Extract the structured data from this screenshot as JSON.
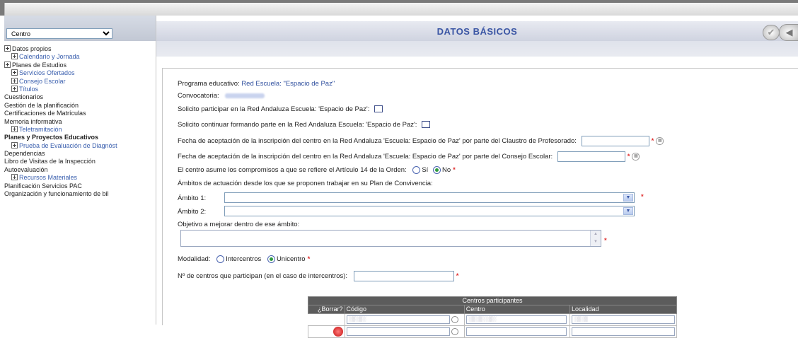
{
  "sidebar": {
    "selector_value": "Centro",
    "items": [
      {
        "label": "Datos propios",
        "expand": true,
        "style": "plain"
      },
      {
        "label": "Calendario y Jornada",
        "expand": true,
        "style": "blue"
      },
      {
        "label": "Planes de Estudios",
        "expand": true,
        "style": "plain"
      },
      {
        "label": "Servicios Ofertados",
        "expand": true,
        "style": "blue"
      },
      {
        "label": "Consejo Escolar",
        "expand": true,
        "style": "blue"
      },
      {
        "label": "Títulos",
        "expand": true,
        "style": "blue"
      },
      {
        "label": "Cuestionarios",
        "expand": false,
        "style": "plain"
      },
      {
        "label": "Gestión de la planificación",
        "expand": false,
        "style": "plain"
      },
      {
        "label": "Certificaciones de Matrículas",
        "expand": false,
        "style": "plain"
      },
      {
        "label": "Memoria informativa",
        "expand": false,
        "style": "plain"
      },
      {
        "label": "Teletramitación",
        "expand": true,
        "style": "blue"
      },
      {
        "label": "Planes y Proyectos Educativos",
        "expand": false,
        "style": "bold"
      },
      {
        "label": "Prueba de Evaluación de Diagnóst",
        "expand": true,
        "style": "blue"
      },
      {
        "label": "Dependencias",
        "expand": false,
        "style": "plain"
      },
      {
        "label": "Libro de Visitas de la Inspección",
        "expand": false,
        "style": "plain"
      },
      {
        "label": "Autoevaluación",
        "expand": false,
        "style": "plain"
      },
      {
        "label": "Recursos Materiales",
        "expand": true,
        "style": "blue"
      },
      {
        "label": "Planificación Servicios PAC",
        "expand": false,
        "style": "plain"
      },
      {
        "label": "Organización y funcionamiento de bil",
        "expand": false,
        "style": "plain"
      }
    ]
  },
  "header": {
    "title": "DATOS BÁSICOS"
  },
  "form": {
    "programa_label": "Programa educativo:",
    "programa_value": "Red Escuela: \"Espacio de Paz\"",
    "convocatoria_label": "Convocatoria:",
    "solicito_participar": "Solicito participar en la Red Andaluza Escuela: 'Espacio de Paz':",
    "solicito_continuar": "Solicito continuar formando parte en la Red Andaluza Escuela: 'Espacio de Paz':",
    "fecha_claustro": "Fecha de aceptación de la inscripción del centro en la Red Andaluza 'Escuela: Espacio de Paz' por parte del Claustro de Profesorado:",
    "fecha_consejo": "Fecha de aceptación de la inscripción del centro en la Red Andaluza 'Escuela: Espacio de Paz' por parte del Consejo Escolar:",
    "compromisos_label": "El centro asume los compromisos a que se refiere el Artículo 14 de la Orden:",
    "opt_si": "Sí",
    "opt_no": "No",
    "ambitos_label": "Ámbitos de actuación desde los que se proponen trabajar en su Plan de Convivencia:",
    "ambito1_label": "Ámbito 1:",
    "ambito2_label": "Ámbito 2:",
    "objetivo_label": "Objetivo a mejorar dentro de ese ámbito:",
    "modalidad_label": "Modalidad:",
    "opt_intercentros": "Intercentros",
    "opt_unicentro": "Unicentro",
    "num_centros_label": "Nº de centros que participan (en el caso de intercentros):",
    "required_mark": "*"
  },
  "table": {
    "caption": "Centros participantes",
    "headers": [
      "¿Borrar?",
      "Código",
      "Centro",
      "Localidad"
    ]
  }
}
